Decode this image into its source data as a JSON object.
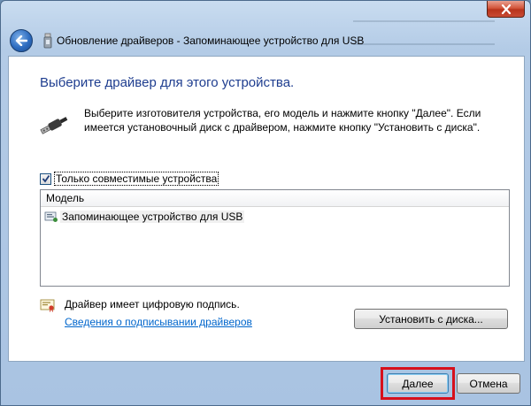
{
  "window": {
    "title": "Обновление драйверов - Запоминающее устройство для USB"
  },
  "page": {
    "heading": "Выберите драйвер для этого устройства.",
    "instructions": "Выберите изготовителя устройства, его модель и нажмите кнопку \"Далее\". Если имеется установочный диск с  драйвером, нажмите кнопку \"Установить с диска\"."
  },
  "compatible_checkbox": {
    "label": "Только совместимые устройства",
    "checked": true
  },
  "model_list": {
    "column_header": "Модель",
    "items": [
      {
        "label": "Запоминающее устройство для USB",
        "icon": "usb-device-icon"
      }
    ]
  },
  "signature": {
    "status_text": "Драйвер имеет цифровую подпись.",
    "link_text": "Сведения о подписывании драйверов",
    "icon": "certificate-icon"
  },
  "buttons": {
    "install_from_disk": "Установить с диска...",
    "next": "Далее",
    "cancel": "Отмена"
  },
  "colors": {
    "heading": "#1e3d8f",
    "link": "#0066cc",
    "highlight": "#d6101c",
    "close_button": "#c84b33"
  }
}
